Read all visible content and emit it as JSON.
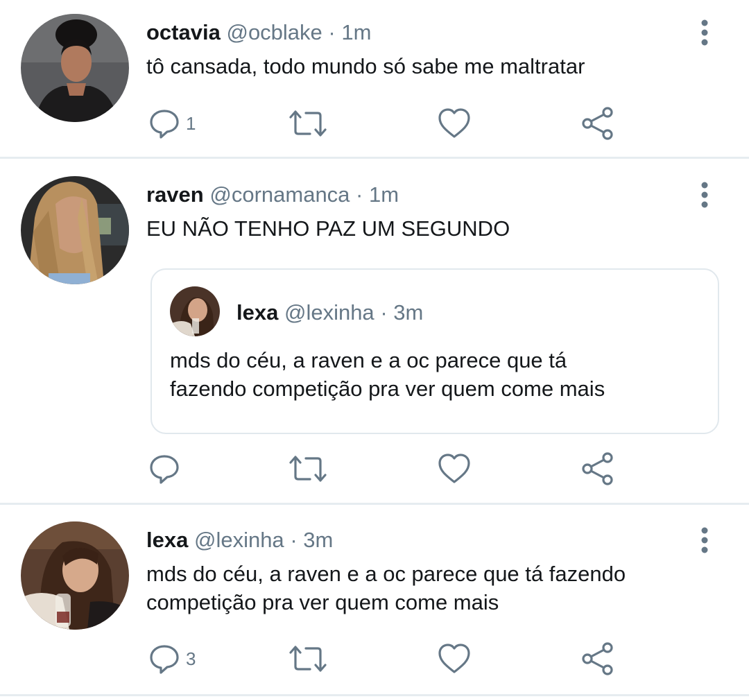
{
  "tweets": [
    {
      "name": "octavia",
      "handle": "@ocblake",
      "separator": "·",
      "time": "1m",
      "text_lines": [
        "tô cansada, todo mundo só sabe me maltratar"
      ],
      "avatar_icon": "avatar-photo",
      "reply_count": "1"
    },
    {
      "name": "raven",
      "handle": "@cornamanca",
      "separator": "·",
      "time": "1m",
      "text_lines": [
        "EU NÃO TENHO PAZ UM SEGUNDO"
      ],
      "avatar_icon": "avatar-photo",
      "reply_count": "",
      "quote": {
        "name": "lexa",
        "handle": "@lexinha",
        "separator": "·",
        "time": "3m",
        "text_lines": [
          "mds do céu, a raven e a oc parece que tá",
          "fazendo competição pra ver quem come mais"
        ]
      }
    },
    {
      "name": "lexa",
      "handle": "@lexinha",
      "separator": "·",
      "time": "3m",
      "text_lines": [
        "mds do céu, a raven e a oc parece que tá fazendo",
        "competição pra ver quem come mais"
      ],
      "avatar_icon": "avatar-photo",
      "reply_count": "3"
    }
  ],
  "colors": {
    "text_primary": "#14171a",
    "text_secondary": "#657786",
    "icon_gray": "#657786",
    "divider": "#e6ecf0",
    "quote_border": "#e1e8ed"
  },
  "icons": [
    "reply-icon",
    "retweet-icon",
    "like-icon",
    "share-icon",
    "more-options-icon"
  ]
}
